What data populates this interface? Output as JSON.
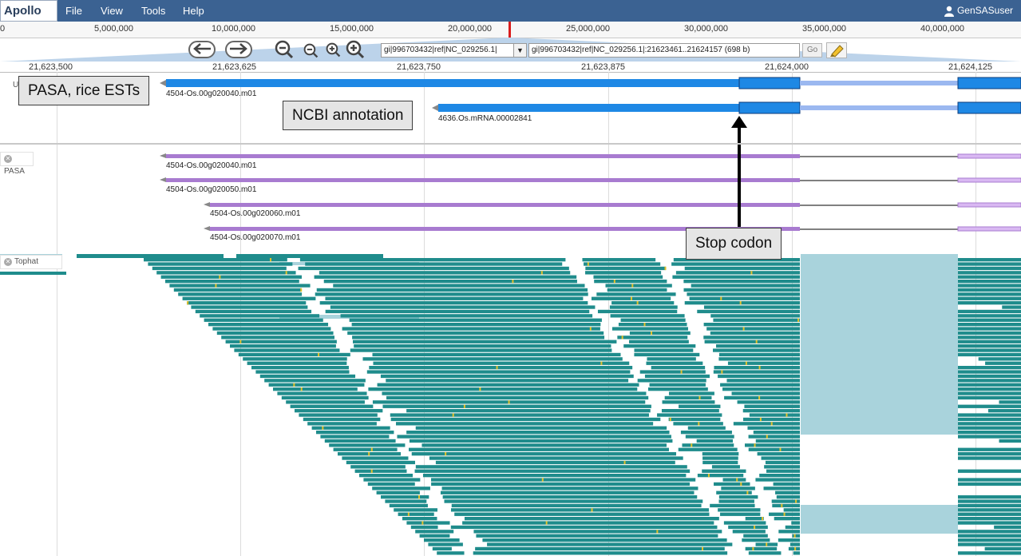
{
  "app": {
    "logo": "Apollo",
    "menu": [
      "File",
      "View",
      "Tools",
      "Help"
    ],
    "user": "GenSASuser"
  },
  "overview_ruler": [
    "5,000,000",
    "10,000,000",
    "15,000,000",
    "20,000,000",
    "25,000,000",
    "30,000,000",
    "35,000,000",
    "40,000,000"
  ],
  "toolbar": {
    "reference_sequence": "gi|996703432|ref|NC_029256.1|",
    "location": "gi|996703432|ref|NC_029256.1|:21623461..21624157 (698 b)",
    "go_label": "Go"
  },
  "detail_ruler": [
    "21,623,500",
    "21,623,625",
    "21,623,750",
    "21,623,875",
    "21,624,000",
    "21,624,125"
  ],
  "user_track": {
    "features": [
      {
        "name": "4504-Os.00g020040.m01"
      },
      {
        "name": "4636.Os.mRNA.00002841"
      }
    ]
  },
  "tracks": {
    "pasa": {
      "label": "PASA",
      "features": [
        "4504-Os.00g020040.m01",
        "4504-Os.00g020050.m01",
        "4504-Os.00g020060.m01",
        "4504-Os.00g020070.m01"
      ]
    },
    "tophat": {
      "label": "Tophat"
    }
  },
  "callouts": {
    "pasa_rice_ests": "PASA, rice ESTs",
    "ncbi_annotation": "NCBI annotation",
    "stop_codon": "Stop codon"
  },
  "colors": {
    "menubar": "#3b6292",
    "cds_blue": "#1e88e5",
    "utr_light": "#9bb8f0",
    "pasa_purple": "#a87bd0",
    "tophat_teal": "#1f8c8c",
    "tophat_intron": "#a9d3dc"
  }
}
